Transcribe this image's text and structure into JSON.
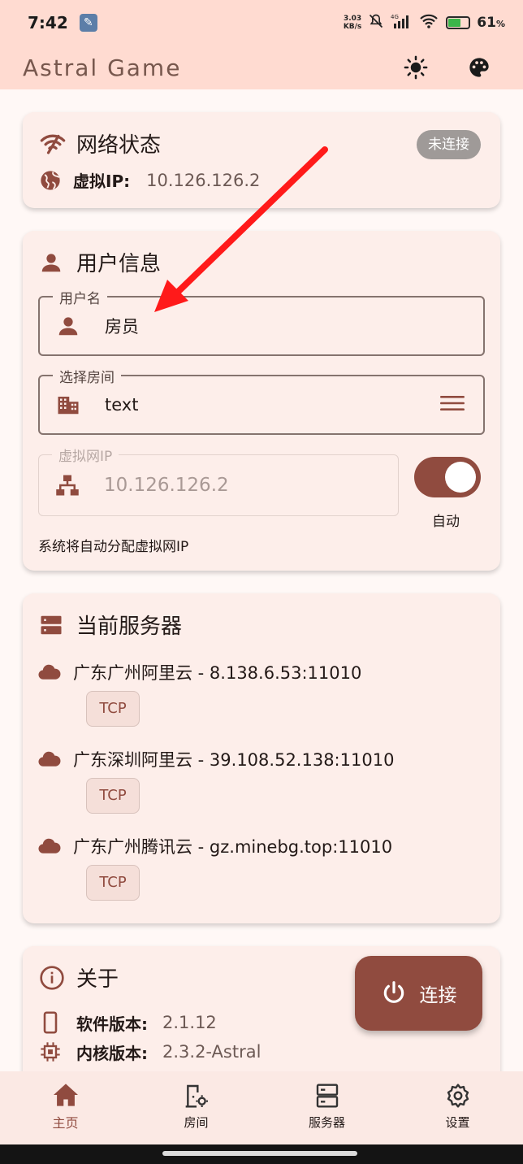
{
  "status_bar": {
    "time": "7:42",
    "speed_value": "3.03",
    "speed_unit": "KB/s",
    "battery": "61",
    "battery_unit": "%"
  },
  "app_bar": {
    "title": "Astral Game"
  },
  "network": {
    "title": "网络状态",
    "status": "未连接",
    "ip_label": "虚拟IP:",
    "ip_value": "10.126.126.2"
  },
  "user": {
    "title": "用户信息",
    "username_label": "用户名",
    "username_value": "房员",
    "room_label": "选择房间",
    "room_value": "text",
    "vip_label": "虚拟网IP",
    "vip_value": "10.126.126.2",
    "auto_label": "自动",
    "hint": "系统将自动分配虚拟网IP"
  },
  "servers": {
    "title": "当前服务器",
    "items": [
      {
        "name": "广东广州阿里云 - 8.138.6.53:11010",
        "protocol": "TCP"
      },
      {
        "name": "广东深圳阿里云 - 39.108.52.138:11010",
        "protocol": "TCP"
      },
      {
        "name": "广东广州腾讯云 - gz.minebg.top:11010",
        "protocol": "TCP"
      }
    ]
  },
  "about": {
    "title": "关于",
    "app_version_label": "软件版本:",
    "app_version_value": "2.1.12",
    "core_version_label": "内核版本:",
    "core_version_value": "2.3.2-Astral"
  },
  "fab": {
    "label": "连接"
  },
  "nav": {
    "home": "主页",
    "room": "房间",
    "server": "服务器",
    "settings": "设置"
  },
  "colors": {
    "primary": "#904b3f",
    "surface": "#fdeeea",
    "appbar": "#ffdbd1",
    "annotation_arrow": "#ff1a1a"
  }
}
